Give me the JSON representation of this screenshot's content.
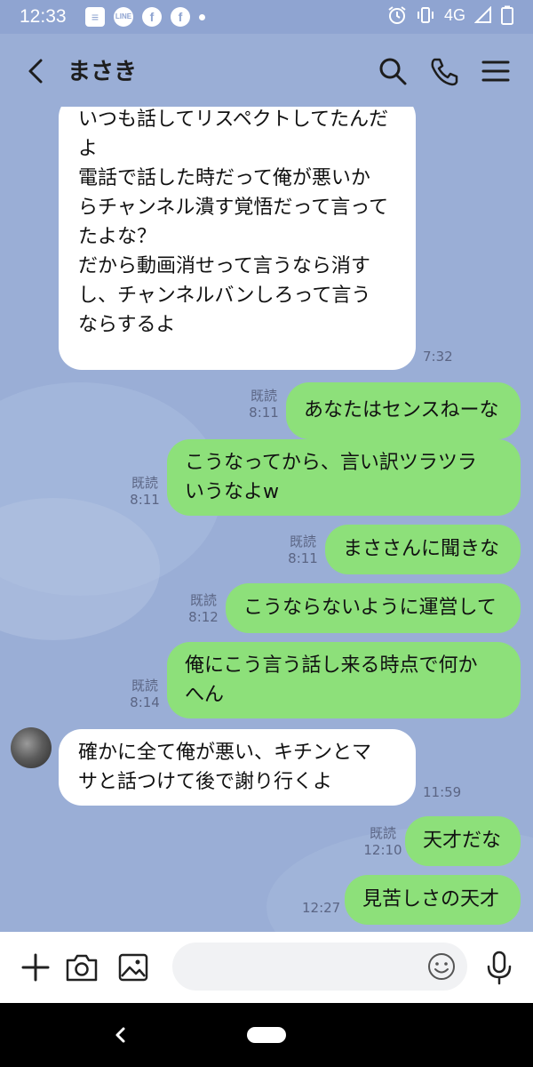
{
  "status_bar": {
    "time": "12:33",
    "network": "4G"
  },
  "header": {
    "title": "まさき"
  },
  "messages": [
    {
      "side": "left",
      "text": "いつも話してリスペクトしてたんだ\nよ\n電話で話した時だって俺が悪いか\nらチャンネル潰す覚悟だって言って\nたよな？\nだから動画消せって言うなら消す\nし、チャンネルバンしろって言う\nならするよ",
      "time": "7:32"
    },
    {
      "side": "right",
      "text": "あなたはセンスねーな",
      "read": "既読",
      "time": "8:11"
    },
    {
      "side": "right",
      "text": "こうなってから、言い訳ツラツラ\nいうなよw",
      "read": "既読",
      "time": "8:11"
    },
    {
      "side": "right",
      "text": "まささんに聞きな",
      "read": "既読",
      "time": "8:11"
    },
    {
      "side": "right",
      "text": "こうならないように運営して",
      "read": "既読",
      "time": "8:12"
    },
    {
      "side": "right",
      "text": "俺にこう言う話し来る時点で何か\nへん",
      "read": "既読",
      "time": "8:14"
    },
    {
      "side": "left",
      "text": "確かに全て俺が悪い、キチンとマ\nサと話つけて後で謝り行くよ",
      "time": "11:59"
    },
    {
      "side": "right",
      "text": "天才だな",
      "read": "既読",
      "time": "12:10"
    },
    {
      "side": "right",
      "text": "見苦しさの天才",
      "time": "12:27"
    }
  ],
  "input": {
    "placeholder": ""
  }
}
